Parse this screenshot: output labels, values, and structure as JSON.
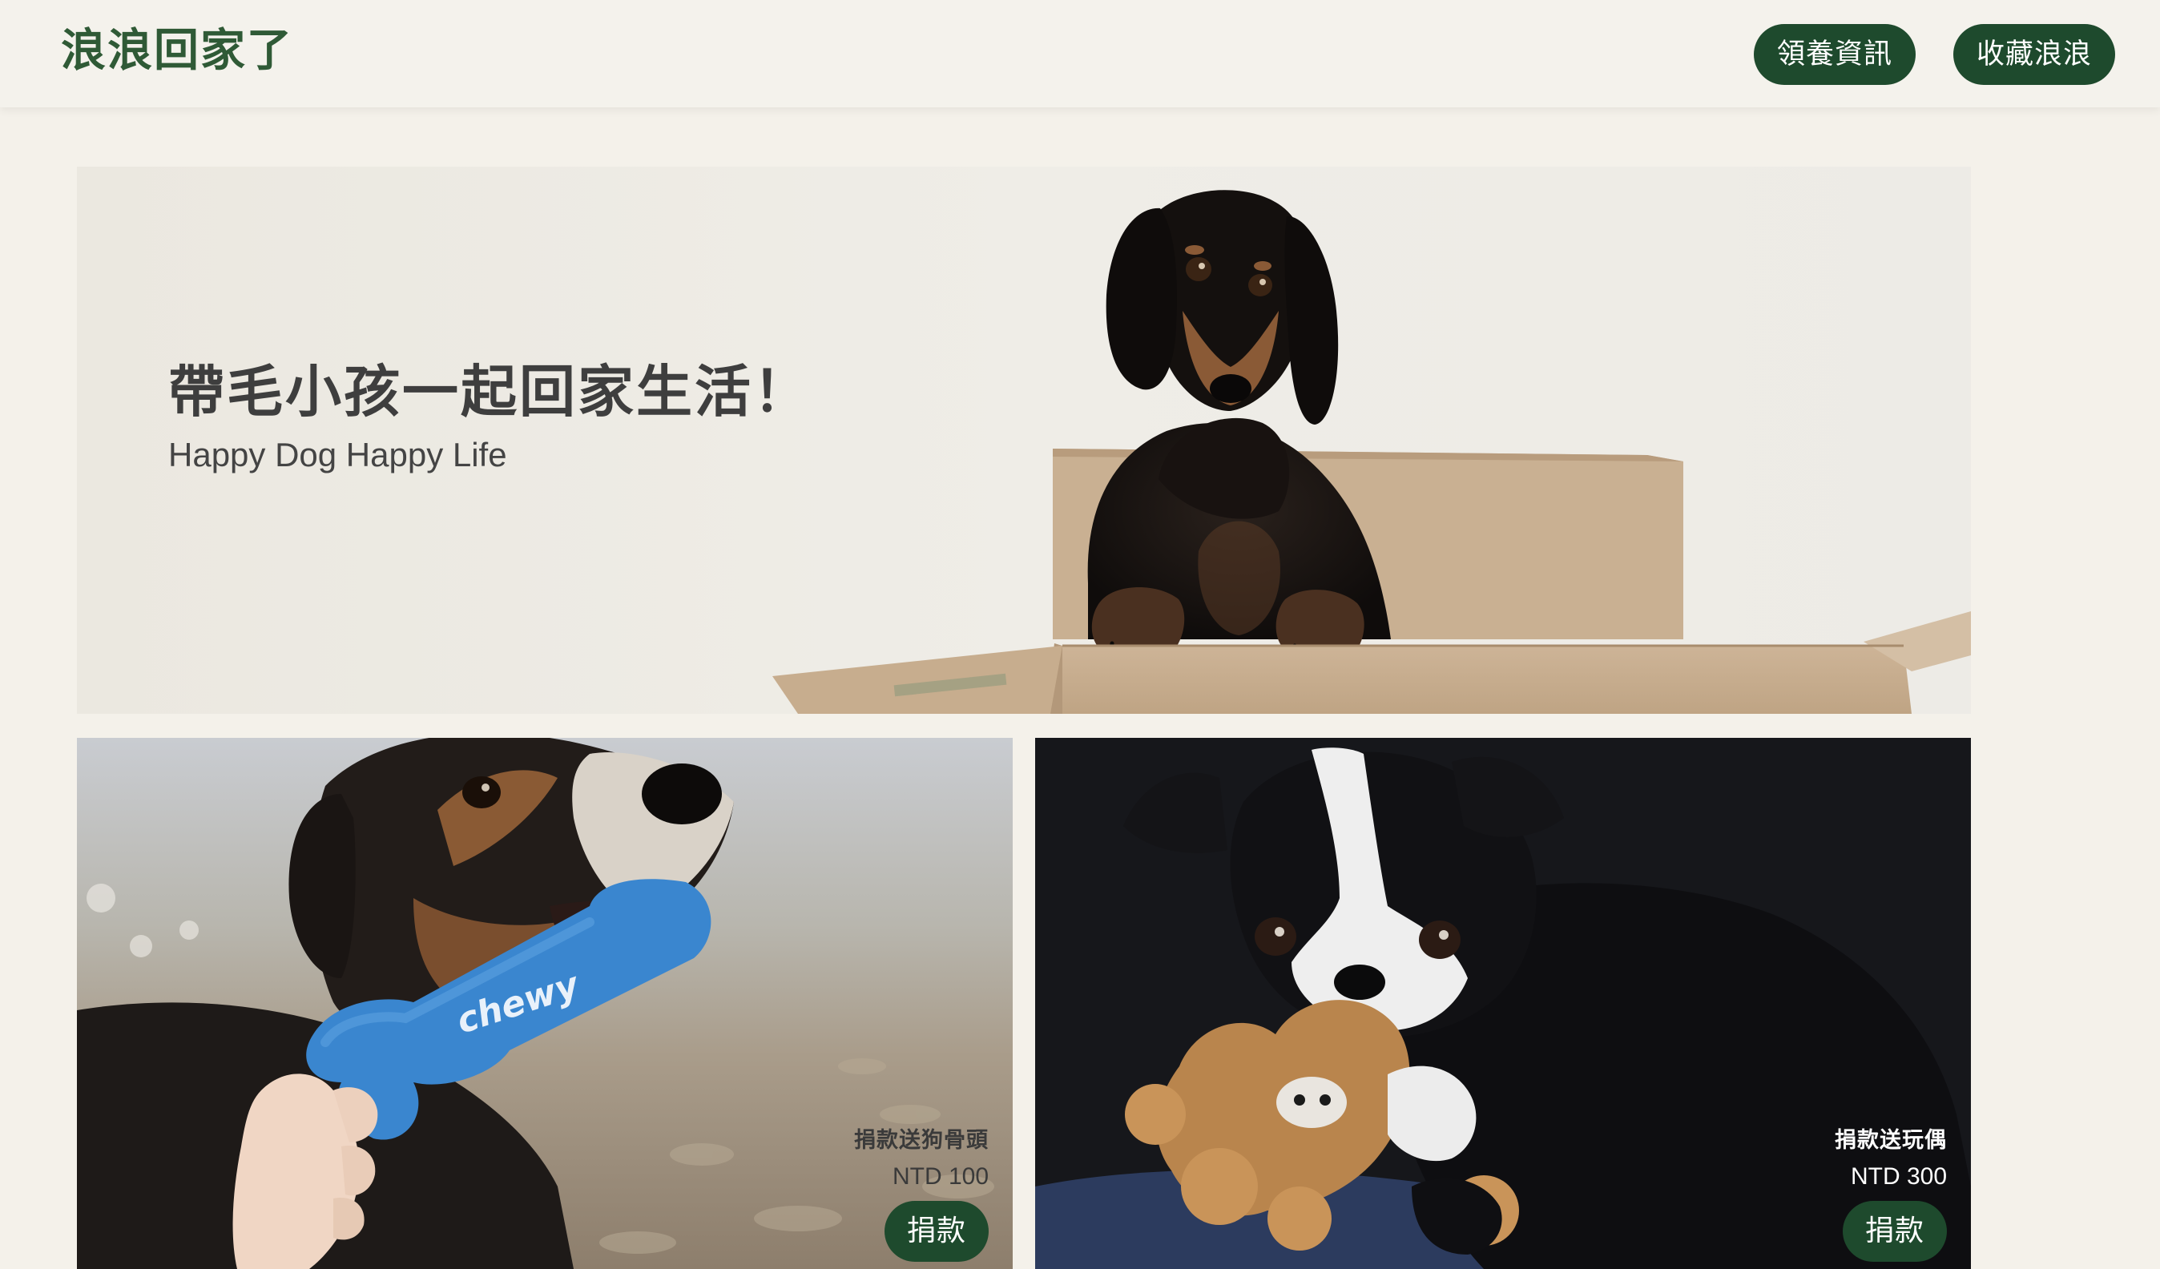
{
  "header": {
    "logo": "浪浪回家了",
    "nav": [
      {
        "label": "領養資訊"
      },
      {
        "label": "收藏浪浪"
      }
    ]
  },
  "hero": {
    "title": "帶毛小孩一起回家生活！",
    "subtitle": "Happy Dog Happy Life",
    "image_icon": "dachshund-in-box-photo"
  },
  "products": [
    {
      "name": "捐款送狗骨頭",
      "price": "NTD 100",
      "button": "捐款",
      "image_icon": "dog-with-bone-toy-photo",
      "toy_text": "chewy"
    },
    {
      "name": "捐款送玩偶",
      "price": "NTD 300",
      "button": "捐款",
      "image_icon": "puppy-with-plush-photo"
    }
  ],
  "colors": {
    "brand_green": "#1e4a2d",
    "logo_green": "#2f5a36",
    "page_background": "#f4f1ea"
  }
}
